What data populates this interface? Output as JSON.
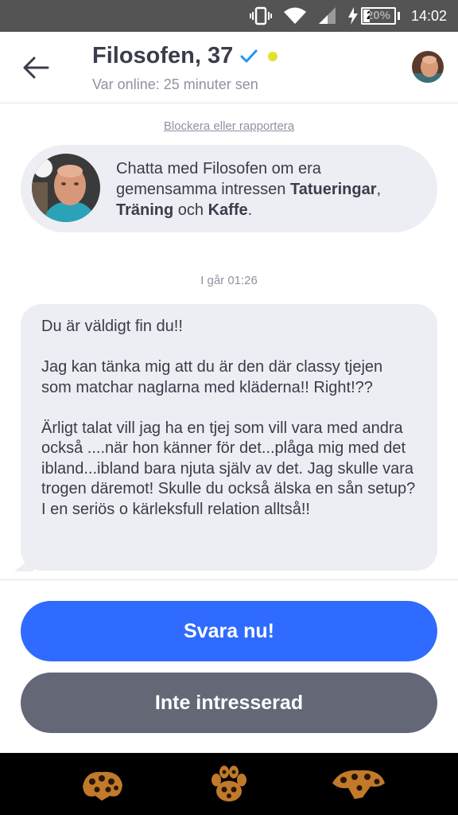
{
  "status_bar": {
    "battery": "20%",
    "battery_level": 0.2,
    "time": "14:02",
    "icons": [
      "vibrate-icon",
      "wifi-icon",
      "signal-icon",
      "charging-icon",
      "battery-icon"
    ]
  },
  "header": {
    "name": "Filosofen, 37",
    "last_online": "Var online: 25 minuter sen",
    "verified_color": "#2196f3",
    "online_dot_color": "#e3e12d"
  },
  "chat": {
    "block_link": "Blockera eller rapportera",
    "intro": {
      "pre": "Chatta med Filosofen om era gemensamma intressen ",
      "interest1": "Tatueringar",
      "sep1": ", ",
      "interest2": "Träning",
      "sep2": " och ",
      "interest3": "Kaffe",
      "end": "."
    },
    "timestamp": "I går 01:26",
    "message": [
      "Du är väldigt fin du!!",
      "Jag kan tänka mig att du är den där classy tjejen som matchar naglarna med kläderna!! Right!??",
      "Ärligt talat vill jag ha en tjej som vill vara med andra också ....när hon känner för det...plåga mig med det ibland...ibland bara njuta själv av det. Jag skulle vara trogen däremot! Skulle du också älska en sån setup? I en seriös o kärleksfull relation alltså!!"
    ]
  },
  "actions": {
    "reply": "Svara nu!",
    "decline": "Inte intresserad",
    "reply_color": "#2f6bff",
    "decline_color": "#646876"
  }
}
